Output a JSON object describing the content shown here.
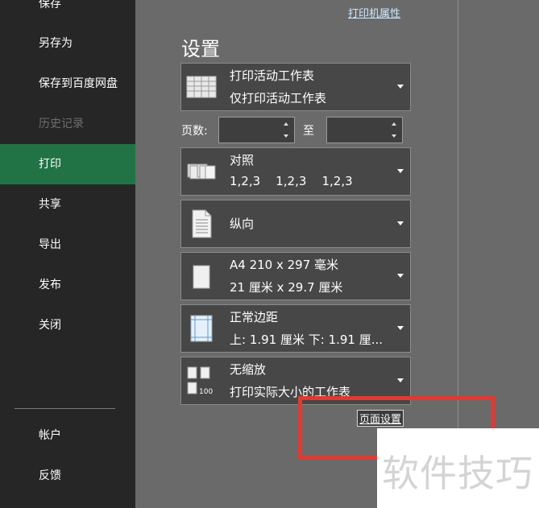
{
  "sidebar": {
    "items": [
      {
        "label": "保存",
        "state": "normal"
      },
      {
        "label": "另存为",
        "state": "normal"
      },
      {
        "label": "保存到百度网盘",
        "state": "normal"
      },
      {
        "label": "历史记录",
        "state": "disabled"
      },
      {
        "label": "打印",
        "state": "selected"
      },
      {
        "label": "共享",
        "state": "normal"
      },
      {
        "label": "导出",
        "state": "normal"
      },
      {
        "label": "发布",
        "state": "normal"
      },
      {
        "label": "关闭",
        "state": "normal"
      }
    ],
    "bottom_items": [
      {
        "label": "帐户"
      },
      {
        "label": "反馈"
      }
    ]
  },
  "main": {
    "printer_properties_link": "打印机属性",
    "settings_title": "设置",
    "print_what": {
      "title": "打印活动工作表",
      "subtitle": "仅打印活动工作表",
      "icon": "sheet-grid-icon"
    },
    "pages": {
      "label": "页数:",
      "from_value": "",
      "to_label": "至",
      "to_value": ""
    },
    "collation": {
      "title": "对照",
      "subtitle": "1,2,3    1,2,3    1,2,3",
      "icon": "collate-icon"
    },
    "orientation": {
      "title": "纵向",
      "icon": "portrait-page-icon"
    },
    "paper_size": {
      "title": "A4 210 x 297 毫米",
      "subtitle": "21 厘米 x 29.7 厘米",
      "icon": "paper-icon"
    },
    "margins": {
      "title": "正常边距",
      "subtitle": "上: 1.91 厘米 下: 1.91 厘...",
      "icon": "margins-icon"
    },
    "scaling": {
      "title": "无缩放",
      "subtitle": "打印实际大小的工作表",
      "icon": "scaling-100-icon",
      "icon_text": "100"
    },
    "page_setup_link": "页面设置"
  },
  "watermark": "软件技巧",
  "colors": {
    "sidebar_bg": "#262626",
    "selected": "#217346",
    "main_bg": "#6a6a6a",
    "panel_bg": "#474747",
    "highlight": "#e03a33"
  }
}
